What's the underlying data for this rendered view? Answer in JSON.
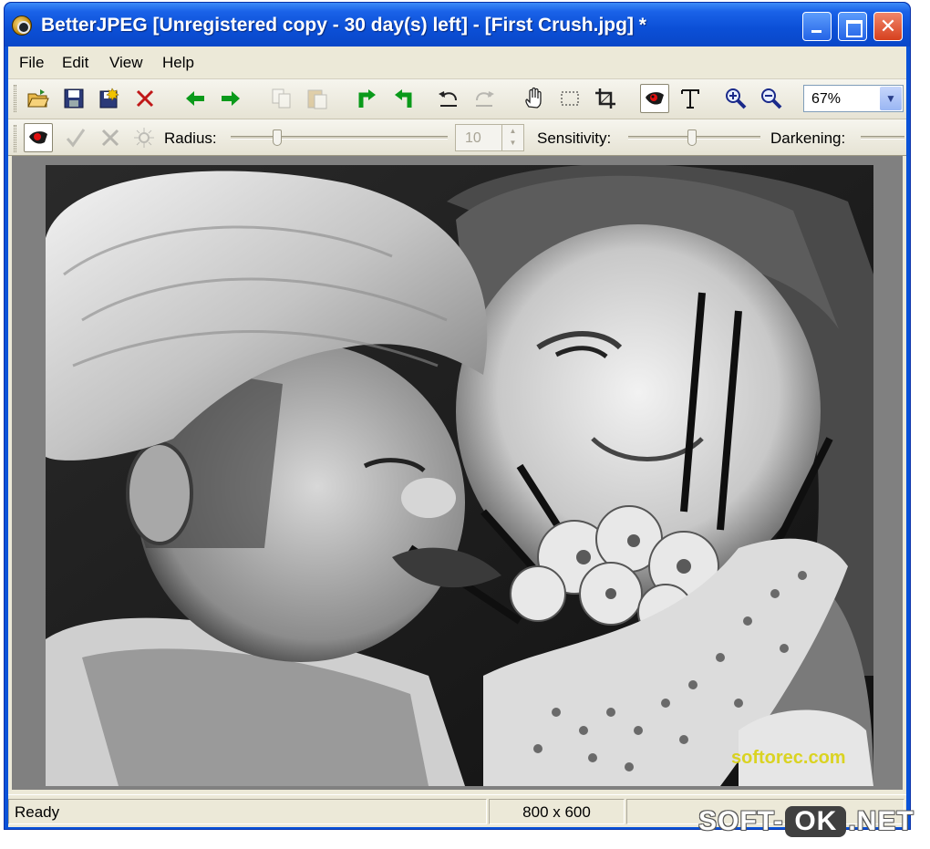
{
  "window": {
    "title": "BetterJPEG [Unregistered copy - 30 day(s) left] - [First Crush.jpg] *",
    "close_glyph": "✕"
  },
  "menu": [
    "File",
    "Edit",
    "View",
    "Help"
  ],
  "toolbar": {
    "icons": [
      "open-folder-icon",
      "save-icon",
      "save-as-icon",
      "close-file-icon",
      "previous-icon",
      "next-icon",
      "copy-icon",
      "paste-icon",
      "rotate-left-icon",
      "rotate-right-icon",
      "undo-icon",
      "redo-icon",
      "hand-pan-icon",
      "rect-select-icon",
      "crop-icon",
      "red-eye-tool-icon",
      "text-tool-icon",
      "zoom-in-icon",
      "zoom-out-icon"
    ],
    "zoom_value": "67%"
  },
  "redeye_bar": {
    "radius_label": "Radius:",
    "radius_value": "10",
    "radius_level": 0.2,
    "sensitivity_label": "Sensitivity:",
    "sensitivity_level": 0.48,
    "darkening_label": "Darkening:"
  },
  "photo": {
    "watermark": "softorec.com"
  },
  "status": {
    "text": "Ready",
    "dimensions": "800 x 600"
  },
  "site_watermark": {
    "left": "SOFT-",
    "ok": "OK",
    "right": ".NET"
  },
  "colors": {
    "titlebar": "#0a52d8",
    "client_bg": "#ece9d8",
    "canvas_bg": "#808080",
    "close_button": "#d6401e",
    "arrow_green": "#0a9a1a"
  }
}
